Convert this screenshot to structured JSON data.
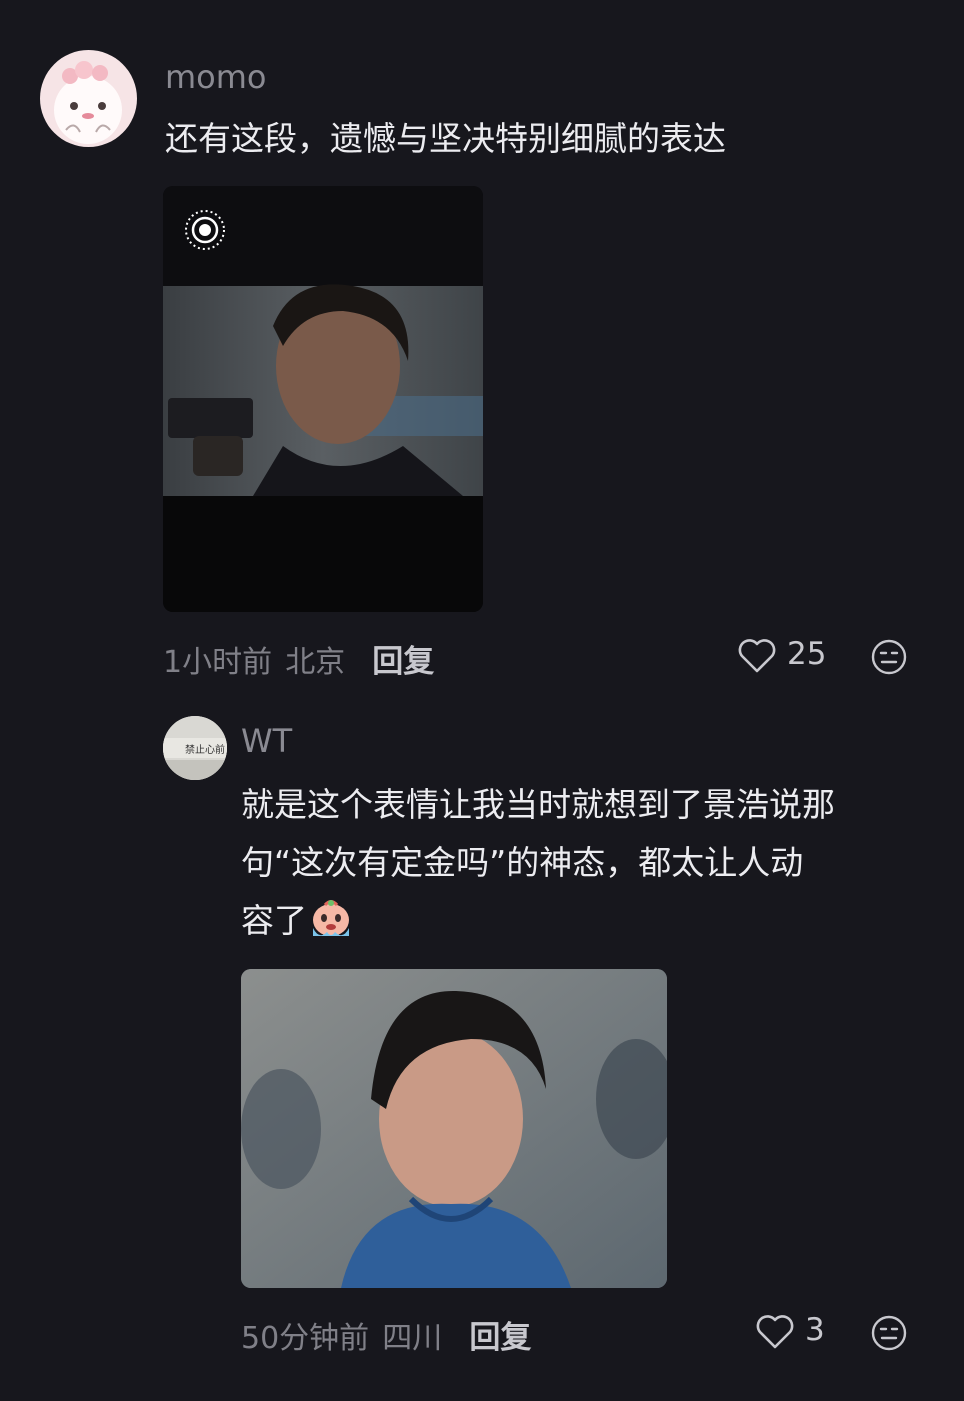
{
  "comment": {
    "username": "momo",
    "text": "还有这段，遗憾与坚决特别细腻的表达",
    "time": "1小时前",
    "location": "北京",
    "reply_label": "回复",
    "likes": "25",
    "media_icon": "live-photo-icon"
  },
  "reply": {
    "username": "WT",
    "avatar_text": "禁止心前",
    "text_lines": [
      "就是这个表情让我当时就想到了景浩说那",
      "句“这次有定金吗”的神态，都太让人动",
      "容了"
    ],
    "emoji": "crying-emoji",
    "time": "50分钟前",
    "location": "四川",
    "reply_label": "回复",
    "likes": "3"
  },
  "colors": {
    "background": "#17171d",
    "text": "#ececf0",
    "muted": "#808088"
  }
}
